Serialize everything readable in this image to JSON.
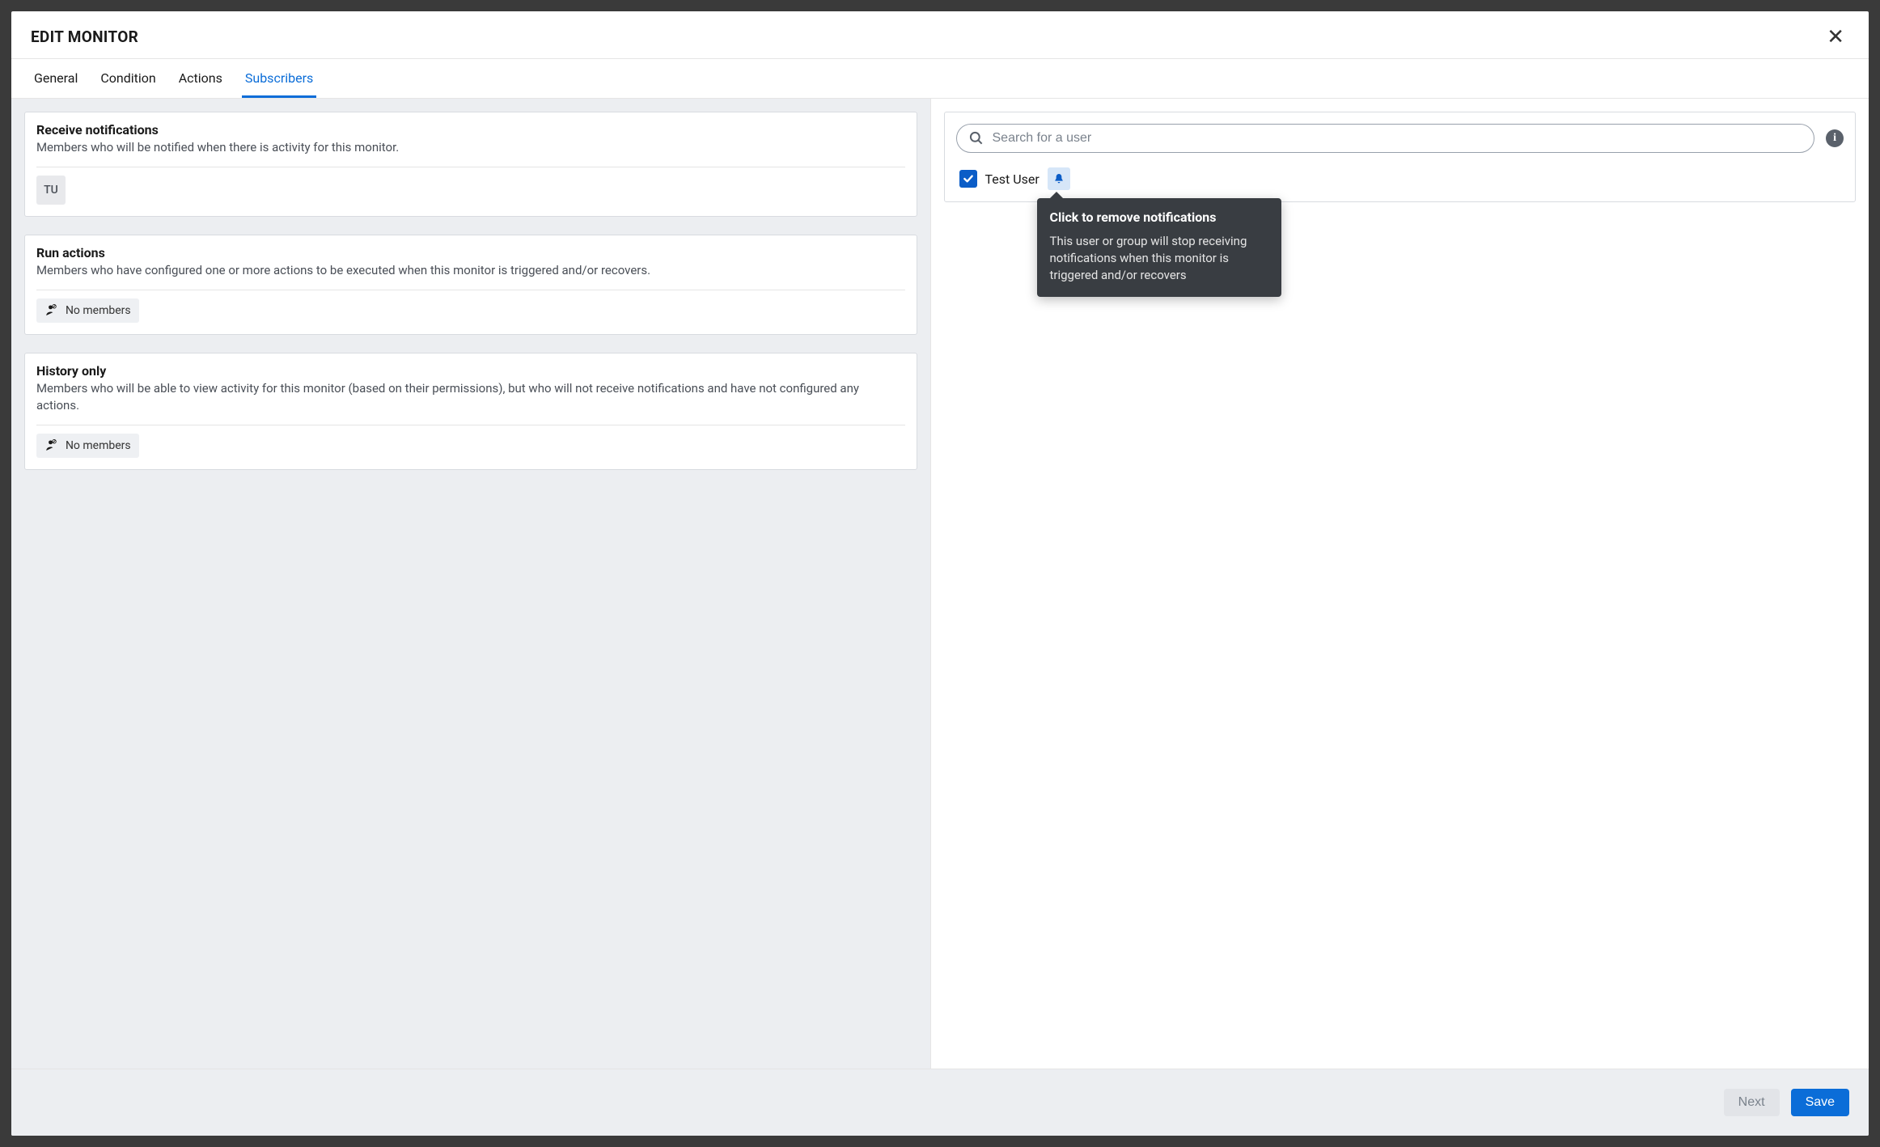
{
  "modal": {
    "title": "EDIT MONITOR",
    "tabs": [
      "General",
      "Condition",
      "Actions",
      "Subscribers"
    ],
    "active_tab_index": 3
  },
  "sections": {
    "receive": {
      "title": "Receive notifications",
      "desc": "Members who will be notified when there is activity for this monitor.",
      "avatar_initials": "TU"
    },
    "run_actions": {
      "title": "Run actions",
      "desc": "Members who have configured one or more actions to be executed when this monitor is triggered and/or recovers.",
      "empty_label": "No members"
    },
    "history": {
      "title": "History only",
      "desc": "Members who will be able to view activity for this monitor (based on their permissions), but who will not receive notifications and have not configured any actions.",
      "empty_label": "No members"
    }
  },
  "search": {
    "placeholder": "Search for a user"
  },
  "user_list": {
    "items": [
      {
        "name": "Test User",
        "checked": true,
        "notifications_on": true
      }
    ]
  },
  "tooltip": {
    "title": "Click to remove notifications",
    "body": "This user or group will stop receiving notifications when this monitor is triggered and/or recovers"
  },
  "footer": {
    "next_label": "Next",
    "save_label": "Save"
  }
}
